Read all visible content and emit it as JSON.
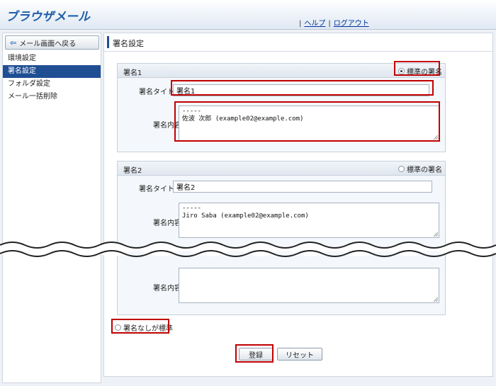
{
  "header": {
    "logo": "ブラウザメール",
    "help": "ヘルプ",
    "logout": "ログアウト"
  },
  "sidebar": {
    "back": "メール画面へ戻る",
    "items": [
      {
        "label": "環境設定"
      },
      {
        "label": "署名設定"
      },
      {
        "label": "フォルダ設定"
      },
      {
        "label": "メール一括削除"
      }
    ]
  },
  "main": {
    "title": "署名設定",
    "sig1": {
      "name": "署名1",
      "default_label": "標準の署名",
      "title_label": "署名タイトル",
      "title_value": "署名1",
      "body_label": "署名内容",
      "body_value": "-----\n佐波 次郎 (example02@example.com)"
    },
    "sig2": {
      "name": "署名2",
      "default_label": "標準の署名",
      "title_label": "署名タイトル",
      "title_value": "署名2",
      "body_label": "署名内容",
      "body_value": "-----\nJiro Saba (example02@example.com)"
    },
    "sig_last": {
      "body_label": "署名内容",
      "body_value": ""
    },
    "no_sig_label": "署名なしが標準",
    "submit": "登録",
    "reset": "リセット"
  },
  "colors": {
    "accent": "#1f4e93",
    "highlight": "#c00000"
  }
}
